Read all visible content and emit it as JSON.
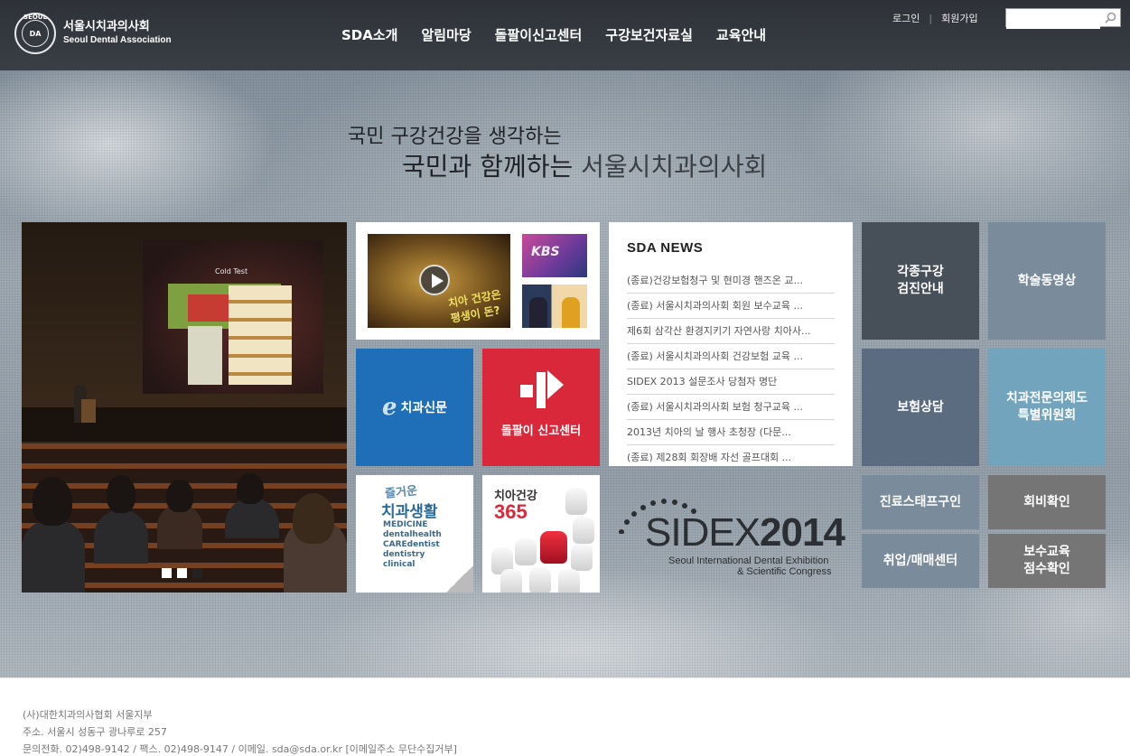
{
  "header": {
    "logo_seal_top": "SEOUL",
    "logo_seal_inner": "DA",
    "logo_ko": "서울시치과의사회",
    "logo_en": "Seoul Dental Association",
    "nav": [
      "SDA소개",
      "알림마당",
      "돌팔이신고센터",
      "구강보건자료실",
      "교육안내"
    ],
    "login": "로그인",
    "separator": "|",
    "signup": "회원가입",
    "search_value": ""
  },
  "slogan": {
    "line1": "국민 구강건강을 생각하는",
    "line2_a": "국민과 함께하는",
    "line2_b": "서울시치과의사회"
  },
  "photo": {
    "screen_title": "Cold Test",
    "slide_count": 3,
    "active_slide": 1
  },
  "video": {
    "caption": "치아 건강은 평생이 돈?",
    "small_label": "KBS"
  },
  "news": {
    "title": "SDA NEWS",
    "items": [
      "(종료)건강보험청구 및 현미경 핸즈온 교...",
      "(종료) 서울시치과의사회 회원 보수교육 ...",
      "제6회 삼각산 환경지키기 자연사랑 치아사...",
      "(종료) 서울시치과의사회 건강보험 교육 ...",
      "SIDEX 2013 설문조사 당첨자 명단",
      "(종료) 서울시치과의사회 보험 청구교육 ...",
      "2013년 치아의 날 행사 초청장 (다문...",
      "(종료) 제28회 회장배 자선 골프대회 ..."
    ]
  },
  "tiles": {
    "dental_news_e": "e",
    "dental_news": "치과신문",
    "report_center": "돌팔이 신고센터",
    "book_t1": "즐거운",
    "book_t2": "치과생활",
    "book_words": "MEDICINE dentalhealth CAREdentist dentistry clinical",
    "tooth_t1": "치아건강",
    "tooth_t2": "365",
    "sidex_prefix": "SIDEX",
    "sidex_year": "2014",
    "sidex_sub1": "Seoul International Dental Exhibition",
    "sidex_sub2": "& Scientific Congress",
    "oral_exam": "각종구강\n검진안내",
    "video_lecture": "학술동영상",
    "insurance": "보험상담",
    "specialist": "치과전문의제도\n특별위원회",
    "staff": "진료스태프구인",
    "fee_check": "회비확인",
    "jobs": "취업/매매센터",
    "education": "보수교육\n점수확인"
  },
  "colors": {
    "header_bg": "#34383e",
    "dark_slate": "#474f59",
    "slate_blue": "#7a8b9c",
    "steel_blue": "#5b6b80",
    "light_blue": "#73a4be",
    "grey": "#757575",
    "blue": "#1e6fb8",
    "red": "#d9283a"
  },
  "footer": {
    "line1": "(사)대한치과의사협회 서울지부",
    "line2": "주소. 서울시 성동구 광나루로 257",
    "line3": "문의전화. 02)498-9142 / 팩스. 02)498-9147 / 이메일. sda@sda.or.kr [이메일주소 무단수집거부]"
  }
}
